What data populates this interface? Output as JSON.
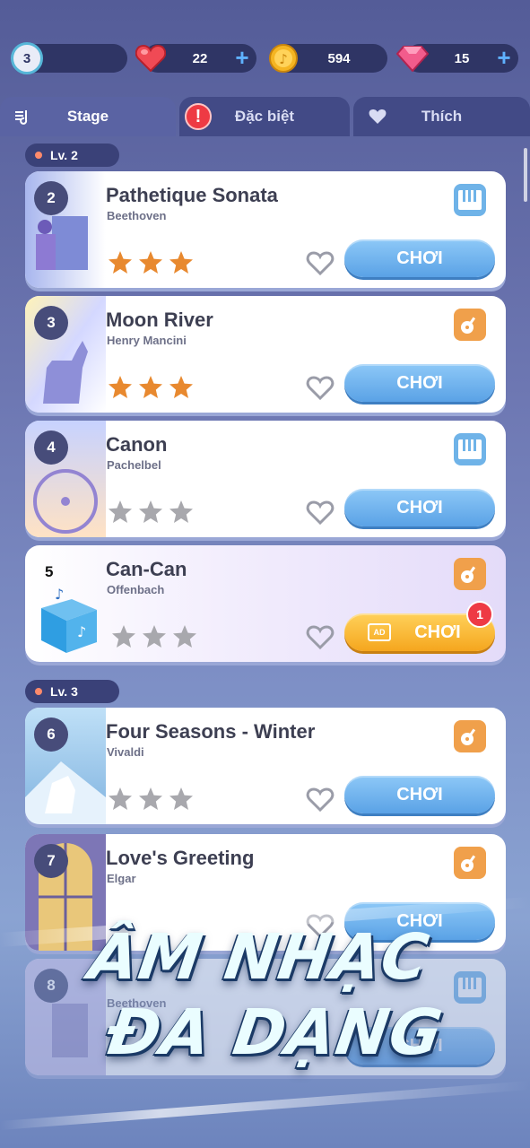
{
  "topbar": {
    "level": "3",
    "hearts": "22",
    "coins": "594",
    "gems": "15"
  },
  "tabs": [
    {
      "label": "Stage"
    },
    {
      "label": "Đặc biệt"
    },
    {
      "label": "Thích"
    }
  ],
  "sections": [
    {
      "label": "Lv. 2"
    },
    {
      "label": "Lv. 3"
    }
  ],
  "songs": [
    {
      "num": "2",
      "title": "Pathetique Sonata",
      "artist": "Beethoven",
      "stars": 3,
      "instrument": "piano-icon",
      "play": "CHƠI"
    },
    {
      "num": "3",
      "title": "Moon River",
      "artist": "Henry Mancini",
      "stars": 3,
      "instrument": "guitar-icon",
      "play": "CHƠI"
    },
    {
      "num": "4",
      "title": "Canon",
      "artist": "Pachelbel",
      "stars": 0,
      "instrument": "piano-icon",
      "play": "CHƠI"
    },
    {
      "num": "5",
      "title": "Can-Can",
      "artist": "Offenbach",
      "stars": 0,
      "instrument": "guitar-icon",
      "play": "CHƠI",
      "ad_label": "AD",
      "badge": "1"
    },
    {
      "num": "6",
      "title": "Four Seasons - Winter",
      "artist": "Vivaldi",
      "stars": 0,
      "instrument": "guitar-icon",
      "play": "CHƠI"
    },
    {
      "num": "7",
      "title": "Love's Greeting",
      "artist": "Elgar",
      "stars": 0,
      "instrument": "guitar-icon",
      "play": "CHƠI"
    },
    {
      "num": "8",
      "title": "",
      "artist": "Beethoven",
      "stars": 0,
      "instrument": "piano-icon",
      "play": "CHƠI"
    }
  ],
  "promo": {
    "line1": "ÂM NHẠC",
    "line2": "ĐA DẠNG"
  },
  "colors": {
    "accent_blue": "#5aa2e6",
    "star_gold": "#e8892f",
    "star_empty": "#a8a8ad",
    "ad_orange": "#f5a61e"
  }
}
